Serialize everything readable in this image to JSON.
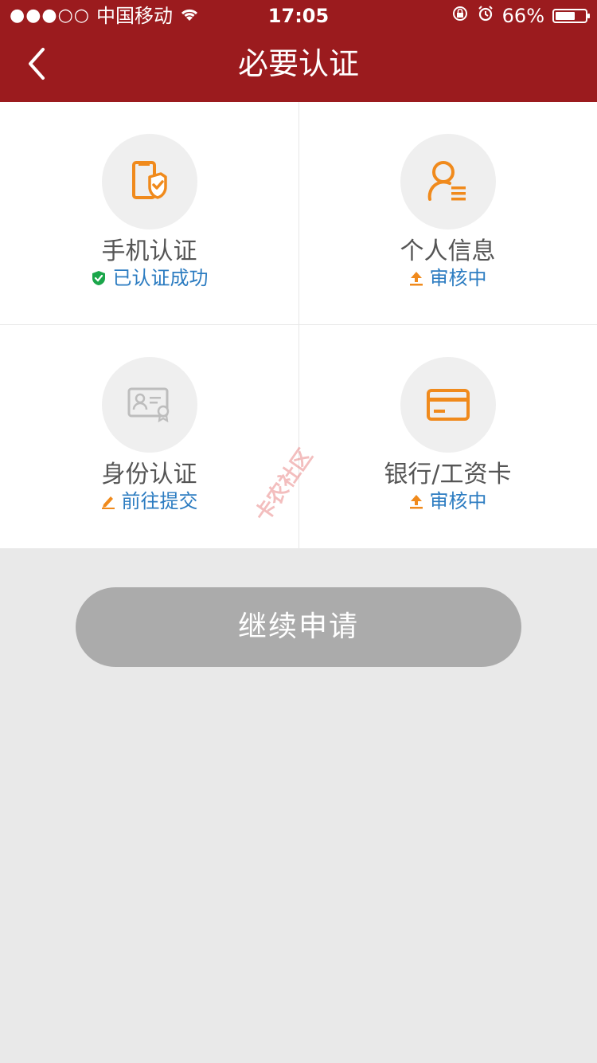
{
  "status_bar": {
    "signal": "●●●○○",
    "carrier": "中国移动",
    "time": "17:05",
    "battery_percent": "66%",
    "battery_level": 0.66
  },
  "nav": {
    "title": "必要认证"
  },
  "cards": [
    {
      "label": "手机认证",
      "status": "已认证成功",
      "status_icon": "verified-shield-icon",
      "icon": "phone-shield-icon"
    },
    {
      "label": "个人信息",
      "status": "审核中",
      "status_icon": "upload-arrow-icon",
      "icon": "person-list-icon"
    },
    {
      "label": "身份认证",
      "status": "前往提交",
      "status_icon": "pencil-icon",
      "icon": "id-card-icon"
    },
    {
      "label": "银行/工资卡",
      "status": "审核中",
      "status_icon": "upload-arrow-icon",
      "icon": "bank-card-icon"
    }
  ],
  "colors": {
    "header": "#9b1b1e",
    "accent_orange": "#f08a1c",
    "status_blue": "#2c7cc1",
    "success_green": "#1aa64a",
    "button_gray": "#ababab"
  },
  "actions": {
    "continue_label": "继续申请"
  },
  "watermark": "卡农社区"
}
